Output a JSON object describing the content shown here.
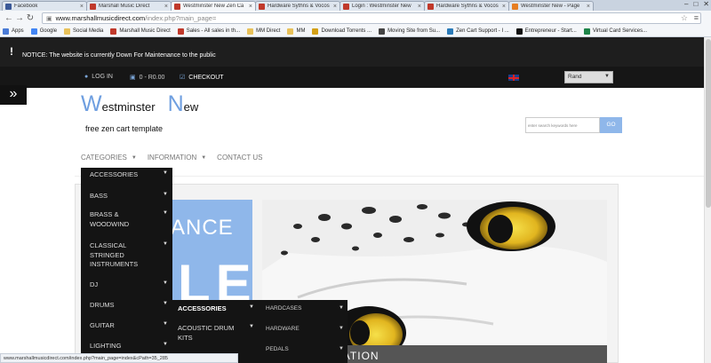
{
  "browser": {
    "tabs": [
      {
        "title": "Facebook",
        "color": "#3b5998"
      },
      {
        "title": "Marshall Music Direct",
        "color": "#c0392b"
      },
      {
        "title": "Westminster New Zen Ca",
        "color": "#c0392b"
      },
      {
        "title": "Hardware Sythns & Vocos",
        "color": "#c0392b"
      },
      {
        "title": "Login : Westminster New",
        "color": "#c0392b"
      },
      {
        "title": "Hardware Sythns & Vocos",
        "color": "#c0392b"
      },
      {
        "title": "Westminster New - Page",
        "color": "#e67e22"
      }
    ],
    "active_tab": 2,
    "window_controls": {
      "minimize": "–",
      "maximize": "□",
      "close": "✕"
    },
    "url_host": "www.marshallmusicdirect.com",
    "url_path": "/index.php?main_page=",
    "bookmarks": [
      {
        "label": "Apps",
        "icon": "apps-icon",
        "color": "#4a7bd6"
      },
      {
        "label": "Google",
        "icon": "google-icon",
        "color": "#4285f4"
      },
      {
        "label": "Social Media",
        "icon": "folder-icon",
        "color": "#e8c15a"
      },
      {
        "label": "Marshall Music Direct",
        "icon": "site-icon",
        "color": "#c0392b"
      },
      {
        "label": "Sales - All sales in th...",
        "icon": "site-icon",
        "color": "#c0392b"
      },
      {
        "label": "MM Direct",
        "icon": "folder-icon",
        "color": "#e8c15a"
      },
      {
        "label": "MM",
        "icon": "folder-icon",
        "color": "#e8c15a"
      },
      {
        "label": "Download Torrents ...",
        "icon": "shield-icon",
        "color": "#d4a017"
      },
      {
        "label": "Moving Site from Su...",
        "icon": "site-icon",
        "color": "#444444"
      },
      {
        "label": "Zen Cart Support - I ...",
        "icon": "zencart-icon",
        "color": "#2b7bb9"
      },
      {
        "label": "Entrepreneur - Start...",
        "icon": "entrepreneur-icon",
        "color": "#111111"
      },
      {
        "label": "Virtual Card Services...",
        "icon": "card-icon",
        "color": "#1e8449"
      }
    ],
    "status_url": "www.marshallmusicdirect.com/index.php?main_page=index&cPath=35_285"
  },
  "notice": {
    "icon": "!",
    "text": "NOTICE: The website is currently Down For Maintenance to the public"
  },
  "topbar": {
    "login": "LOG IN",
    "cart": "0 - R0.00",
    "checkout": "CHECKOUT",
    "currency": "Rand"
  },
  "logo": {
    "w": "W",
    "rest1": "estminster",
    "n": "N",
    "rest2": "ew"
  },
  "tagline": "free zen cart template",
  "search": {
    "placeholder": "enter search keywords here",
    "button": "GO"
  },
  "nav": {
    "categories": "CATEGORIES",
    "information": "INFORMATION",
    "contact": "CONTACT US"
  },
  "menu_categories": [
    {
      "label": "ACCESSORIES"
    },
    {
      "label": "BASS"
    },
    {
      "label": "BRASS & WOODWIND"
    },
    {
      "label": "CLASSICAL STRINGED INSTRUMENTS"
    },
    {
      "label": "DJ"
    },
    {
      "label": "DRUMS"
    },
    {
      "label": "GUITAR"
    },
    {
      "label": "LIGHTING"
    }
  ],
  "menu_drums": [
    {
      "label": "ACCESSORIES"
    },
    {
      "label": "ACOUSTIC DRUM KITS"
    }
  ],
  "menu_accessories": [
    {
      "label": "HARDCASES"
    },
    {
      "label": "HARDWARE"
    },
    {
      "label": "PEDALS"
    }
  ],
  "banner": {
    "word1": "ANCE",
    "word2": "LE"
  },
  "hero_caption": "PRE INSTALLATION"
}
